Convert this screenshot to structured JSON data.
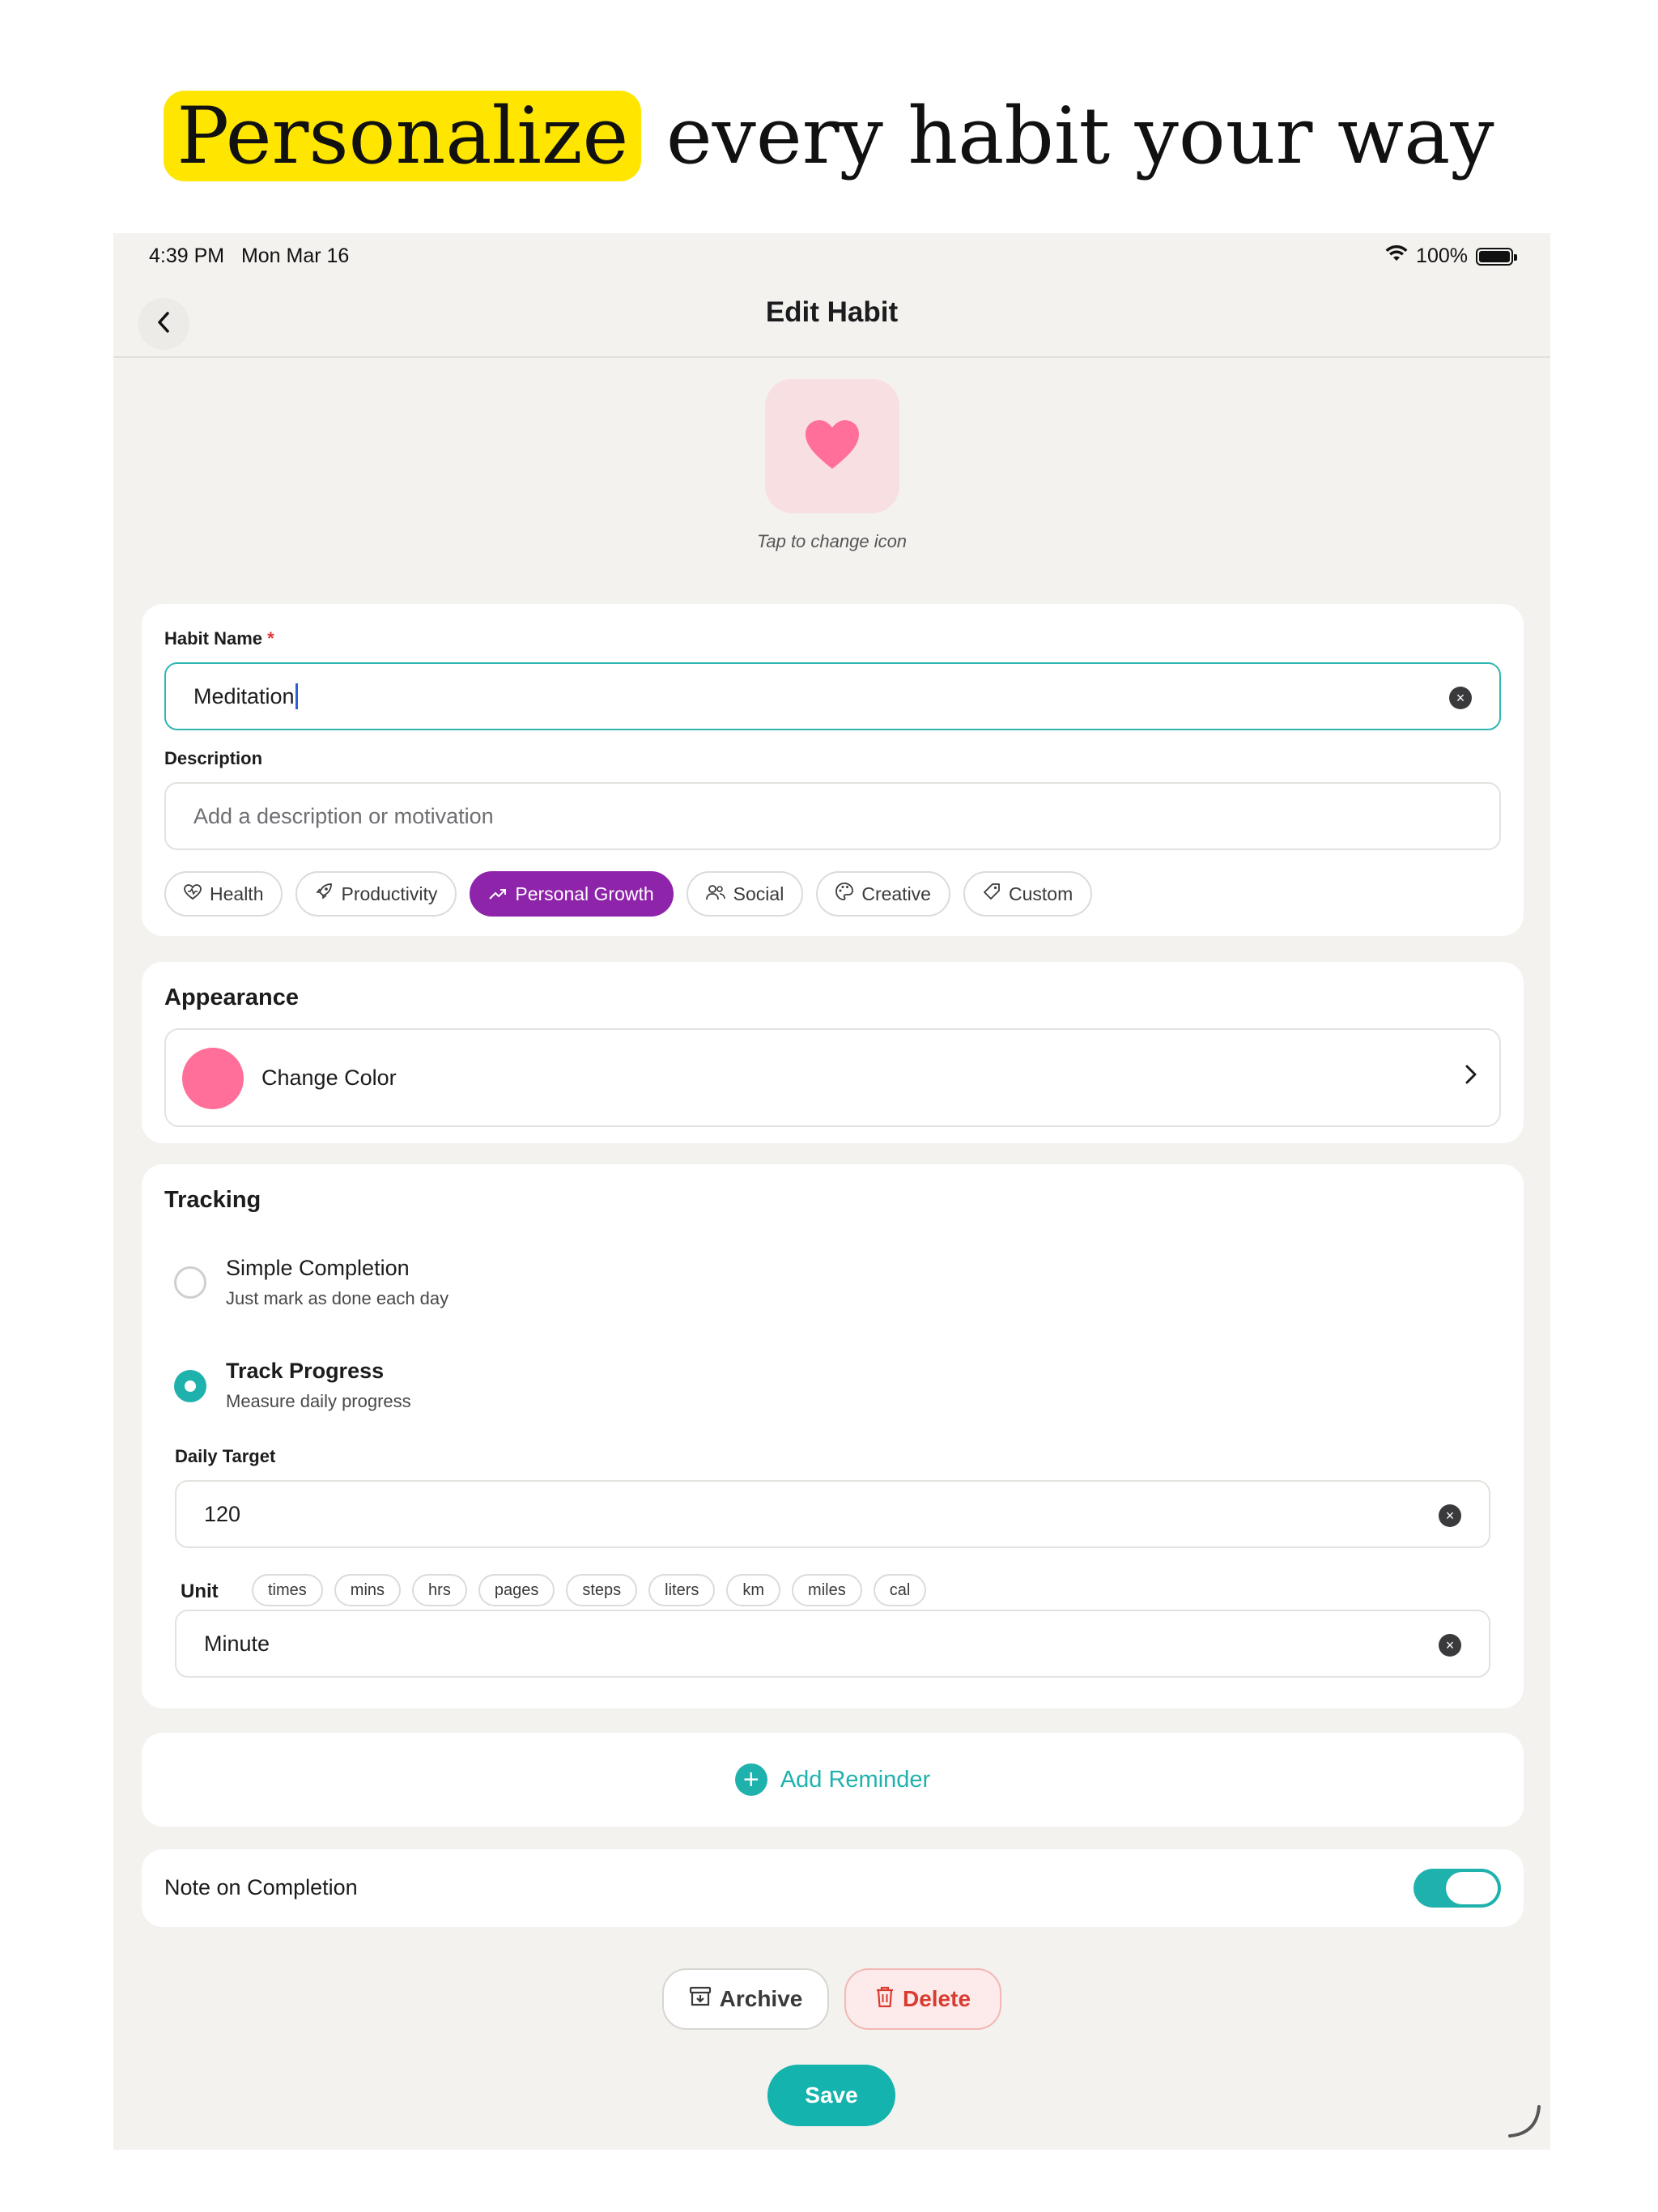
{
  "headline": {
    "highlight": "Personalize",
    "rest": "every habit your way"
  },
  "status_bar": {
    "time": "4:39 PM",
    "date": "Mon Mar 16",
    "battery": "100%",
    "wifi_icon": "wifi-icon",
    "battery_icon": "battery-icon"
  },
  "nav": {
    "title": "Edit Habit",
    "back_icon": "chevron-left-icon"
  },
  "icon_picker": {
    "icon": "heart-icon",
    "color": "#ff6f9a",
    "caption": "Tap to change icon"
  },
  "details": {
    "name_label": "Habit Name",
    "required_mark": "*",
    "name_value": "Meditation",
    "description_label": "Description",
    "description_placeholder": "Add a description or motivation",
    "categories": [
      {
        "label": "Health",
        "icon": "heart-pulse-icon",
        "selected": false
      },
      {
        "label": "Productivity",
        "icon": "rocket-icon",
        "selected": false
      },
      {
        "label": "Personal Growth",
        "icon": "trending-up-icon",
        "selected": true
      },
      {
        "label": "Social",
        "icon": "users-icon",
        "selected": false
      },
      {
        "label": "Creative",
        "icon": "palette-icon",
        "selected": false
      },
      {
        "label": "Custom",
        "icon": "tag-icon",
        "selected": false
      }
    ],
    "accent_color": "#8e24aa"
  },
  "appearance": {
    "title": "Appearance",
    "change_color_label": "Change Color",
    "color": "#ff6f9a"
  },
  "tracking": {
    "title": "Tracking",
    "options": [
      {
        "title": "Simple Completion",
        "subtitle": "Just mark as done each day",
        "selected": false
      },
      {
        "title": "Track Progress",
        "subtitle": "Measure daily progress",
        "selected": true
      }
    ],
    "daily_target_label": "Daily Target",
    "daily_target_value": "120",
    "unit_label": "Unit",
    "units": [
      "times",
      "mins",
      "hrs",
      "pages",
      "steps",
      "liters",
      "km",
      "miles",
      "cal"
    ],
    "unit_value": "Minute"
  },
  "reminder": {
    "label": "Add Reminder",
    "icon": "plus-circle-icon"
  },
  "note": {
    "label": "Note on Completion",
    "enabled": true
  },
  "actions": {
    "archive": "Archive",
    "delete": "Delete",
    "save": "Save"
  },
  "colors": {
    "teal": "#1fb2ad",
    "danger": "#d93b31",
    "background": "#f3f2ef"
  }
}
